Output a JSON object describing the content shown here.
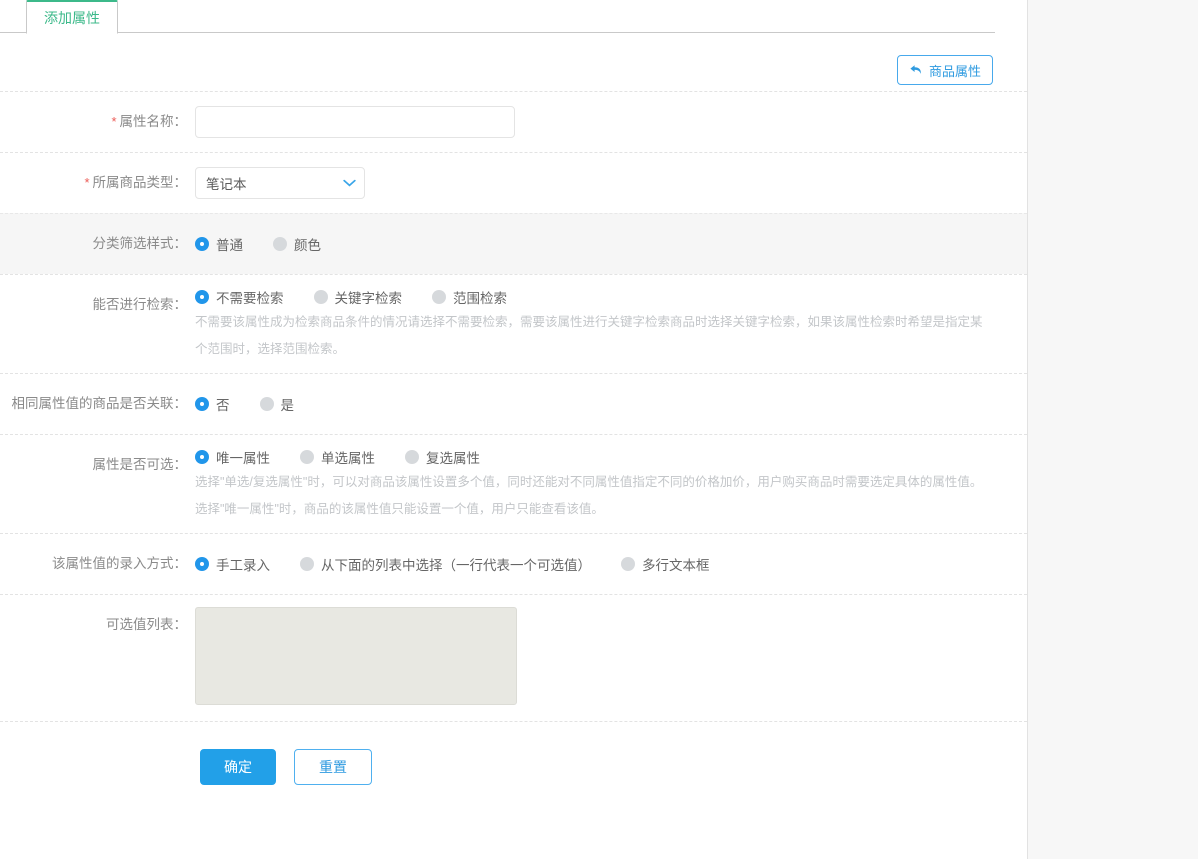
{
  "tabs": [
    {
      "label": "添加属性"
    }
  ],
  "toolbar": {
    "back_label": "商品属性",
    "back_icon": "back-arrow-icon"
  },
  "form": {
    "attr_name": {
      "label": "属性名称：",
      "required": true,
      "value": "",
      "placeholder": ""
    },
    "product_type": {
      "label": "所属商品类型：",
      "required": true,
      "selected": "笔记本",
      "chevron_icon": "chevron-down-icon"
    },
    "filter_style": {
      "label": "分类筛选样式：",
      "options": [
        {
          "label": "普通",
          "selected": true
        },
        {
          "label": "颜色",
          "selected": false
        }
      ]
    },
    "searchable": {
      "label": "能否进行检索：",
      "options": [
        {
          "label": "不需要检索",
          "selected": true
        },
        {
          "label": "关键字检索",
          "selected": false
        },
        {
          "label": "范围检索",
          "selected": false
        }
      ],
      "help": "不需要该属性成为检索商品条件的情况请选择不需要检索，需要该属性进行关键字检索商品时选择关键字检索，如果该属性检索时希望是指定某个范围时，选择范围检索。"
    },
    "same_value_related": {
      "label": "相同属性值的商品是否关联：",
      "options": [
        {
          "label": "否",
          "selected": true
        },
        {
          "label": "是",
          "selected": false
        }
      ]
    },
    "selectable": {
      "label": "属性是否可选：",
      "options": [
        {
          "label": "唯一属性",
          "selected": true
        },
        {
          "label": "单选属性",
          "selected": false
        },
        {
          "label": "复选属性",
          "selected": false
        }
      ],
      "help": "选择\"单选/复选属性\"时，可以对商品该属性设置多个值，同时还能对不同属性值指定不同的价格加价，用户购买商品时需要选定具体的属性值。选择\"唯一属性\"时，商品的该属性值只能设置一个值，用户只能查看该值。"
    },
    "input_method": {
      "label": "该属性值的录入方式：",
      "options": [
        {
          "label": "手工录入",
          "selected": true
        },
        {
          "label": "从下面的列表中选择（一行代表一个可选值）",
          "selected": false
        },
        {
          "label": "多行文本框",
          "selected": false
        }
      ]
    },
    "value_list": {
      "label": "可选值列表：",
      "value": "",
      "placeholder": "",
      "disabled": true
    }
  },
  "actions": {
    "submit_label": "确定",
    "reset_label": "重置"
  },
  "colors": {
    "tab_accent": "#3cb98a",
    "primary": "#22a0e8",
    "link": "#2f9be0",
    "required": "#ec5b56",
    "radio_on": "#2196ea",
    "radio_off": "#d6d9dc"
  }
}
